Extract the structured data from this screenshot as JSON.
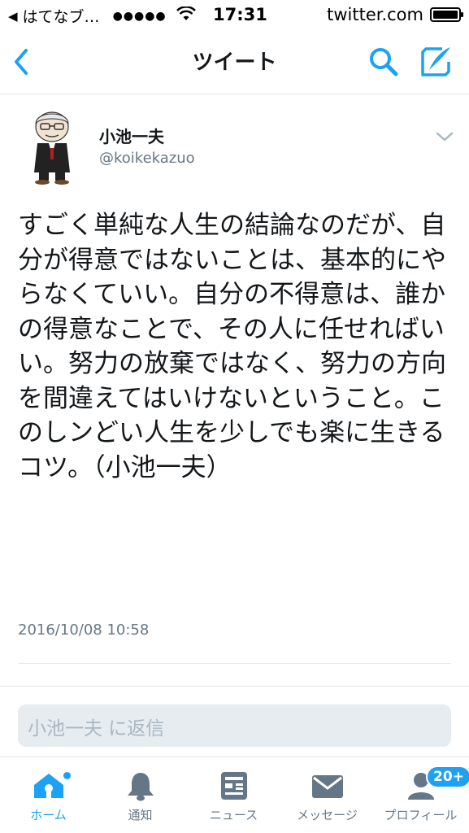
{
  "status_bar": {
    "back_app": "はてなブ…",
    "signal": "●●●●●",
    "time": "17:31",
    "domain": "twitter.com"
  },
  "nav": {
    "title": "ツイート",
    "icons": [
      "chevron-left-icon",
      "search-icon",
      "compose-icon"
    ]
  },
  "tweet": {
    "author_name": "小池一夫",
    "author_handle": "@koikekazuo",
    "text": "すごく単純な人生の結論なのだが、自分が得意ではないことは、基本的にやらなくていい。自分の不得意は、誰かの得意なことで、その人に任せればいい。努力の放棄ではなく、努力の方向を間違えてはいけないということ。このしンどい人生を少しでも楽に生きるコツ。（小池一夫）",
    "timestamp": "2016/10/08 10:58"
  },
  "reply": {
    "placeholder": "小池一夫 に返信"
  },
  "tab_bar": {
    "items": [
      {
        "label": "ホーム",
        "icon": "home-icon",
        "active": true
      },
      {
        "label": "通知",
        "icon": "bell-icon",
        "active": false
      },
      {
        "label": "ニュース",
        "icon": "news-icon",
        "active": false
      },
      {
        "label": "メッセージ",
        "icon": "envelope-icon",
        "active": false
      },
      {
        "label": "プロフィール",
        "icon": "profile-icon",
        "active": false,
        "badge": "20+"
      }
    ]
  },
  "colors": {
    "accent": "#1da1f2",
    "text": "#14171a",
    "muted": "#657786",
    "divider": "#e1e8ed",
    "reply_bg": "#e6ecf0"
  }
}
